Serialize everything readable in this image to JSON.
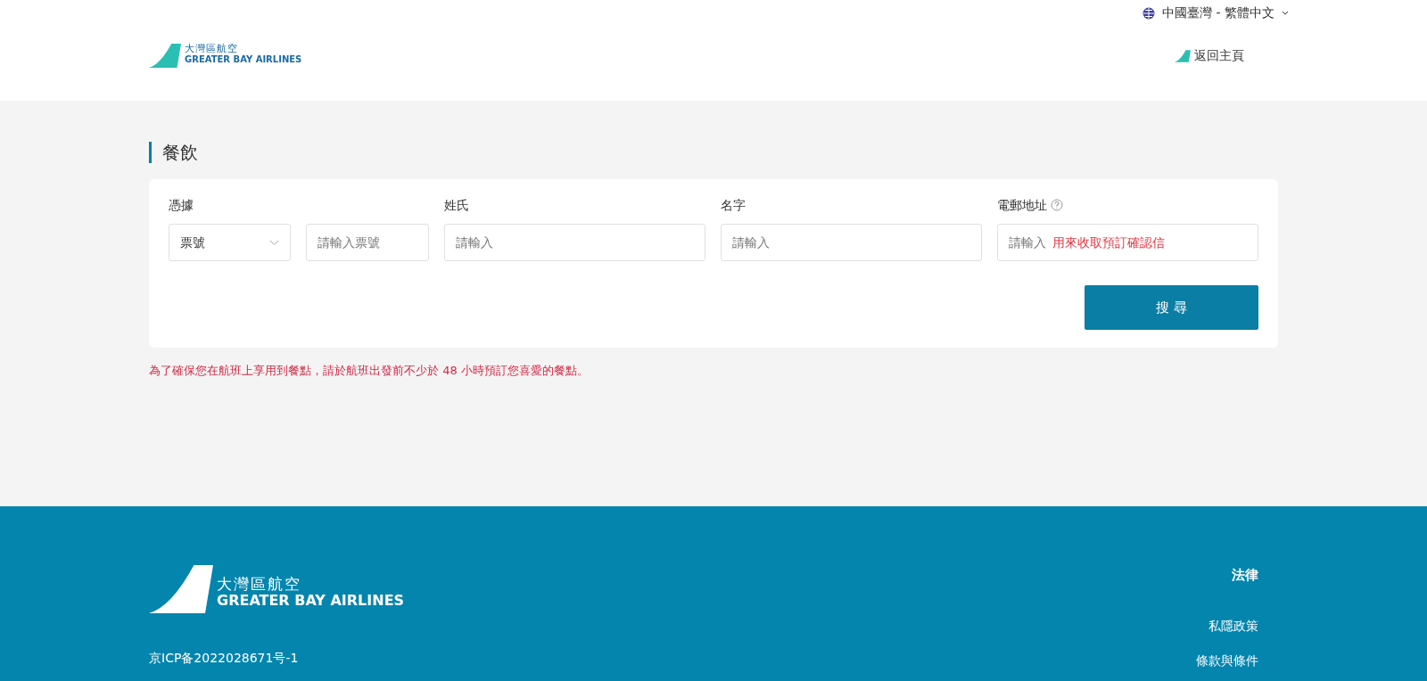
{
  "top_bar": {
    "language": "中國臺灣 - 繁體中文"
  },
  "header": {
    "logo": {
      "chinese": "大灣區航空",
      "english": "GREATER BAY AIRLINES"
    },
    "home_link": "返回主頁"
  },
  "page_title": "餐飲",
  "form": {
    "fields": [
      {
        "kind": "select",
        "label": "憑據",
        "value": "票號"
      },
      {
        "kind": "input",
        "placeholder": "請輸入票號"
      },
      {
        "kind": "input",
        "label": "姓氏",
        "placeholder": "請輸入"
      },
      {
        "kind": "input",
        "label": "名字",
        "placeholder": "請輸入"
      },
      {
        "kind": "hint_input",
        "label": "電郵地址",
        "placeholder": "請輸入",
        "hint": "用來收取預訂確認信"
      }
    ],
    "search_button": "搜 尋"
  },
  "notice": "為了確保您在航班上享用到餐點，請於航班出發前不少於 48 小時預訂您喜愛的餐點。",
  "footer": {
    "logo": {
      "chinese": "大灣區航空",
      "english": "GREATER BAY AIRLINES"
    },
    "icp": "京ICP备2022028671号-1",
    "legal_heading": "法律",
    "legal_links": [
      "私隱政策",
      "條款與條件"
    ]
  }
}
